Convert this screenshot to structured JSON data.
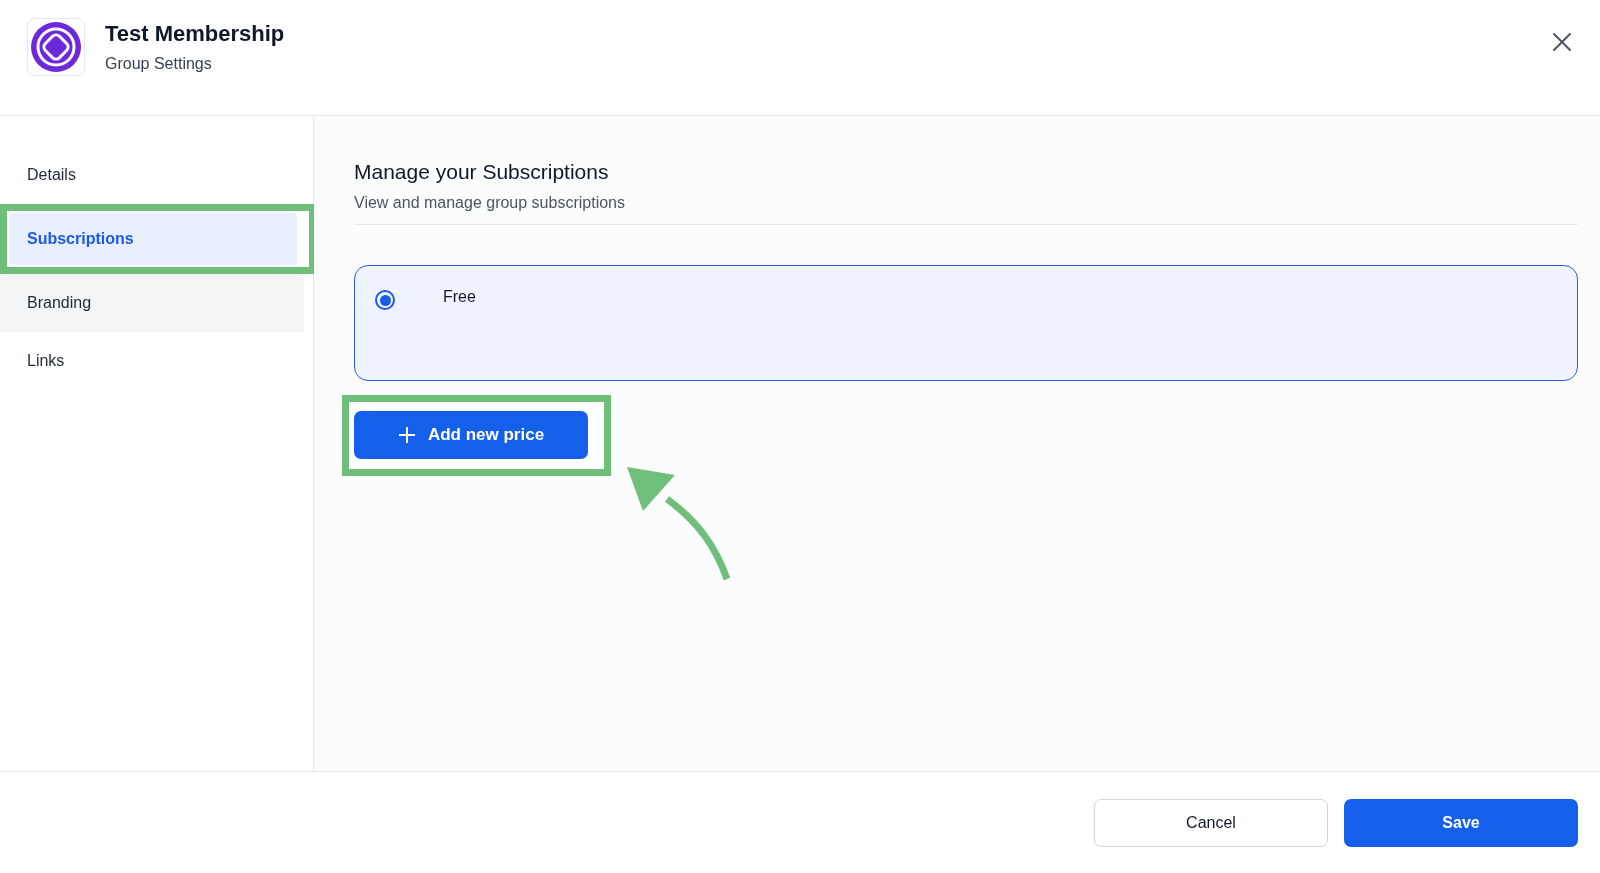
{
  "header": {
    "title": "Test Membership",
    "subtitle": "Group Settings"
  },
  "sidebar": {
    "items": [
      {
        "label": "Details",
        "selected": false,
        "hovered": false,
        "highlighted": false
      },
      {
        "label": "Subscriptions",
        "selected": true,
        "hovered": false,
        "highlighted": true
      },
      {
        "label": "Branding",
        "selected": false,
        "hovered": true,
        "highlighted": false
      },
      {
        "label": "Links",
        "selected": false,
        "hovered": false,
        "highlighted": false
      }
    ]
  },
  "content": {
    "title": "Manage your Subscriptions",
    "subtitle": "View and manage group subscriptions",
    "prices": [
      {
        "label": "Free",
        "selected": true
      }
    ],
    "add_button": {
      "label": "Add new price",
      "highlighted": true
    }
  },
  "footer": {
    "buttons": [
      {
        "label": "Cancel",
        "kind": "secondary"
      },
      {
        "label": "Save",
        "kind": "primary"
      }
    ]
  }
}
